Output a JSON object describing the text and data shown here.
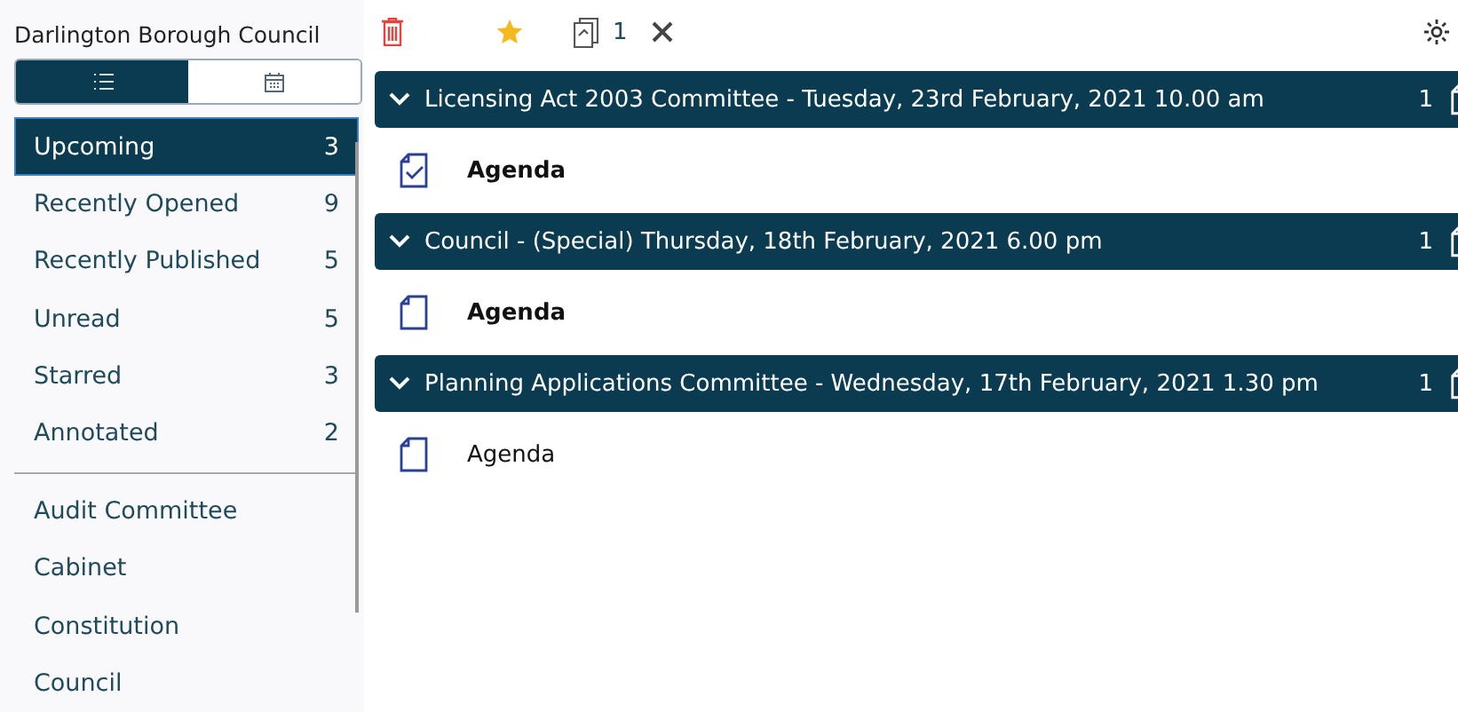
{
  "app_title": "Darlington Borough Council",
  "view_toggle": [
    {
      "kind": "list",
      "selected": true
    },
    {
      "kind": "calendar",
      "selected": false
    }
  ],
  "filters": [
    {
      "label": "Upcoming",
      "count": "3",
      "selected": true
    },
    {
      "label": "Recently Opened",
      "count": "9",
      "selected": false
    },
    {
      "label": "Recently Published",
      "count": "5",
      "selected": false
    },
    {
      "label": "Unread",
      "count": "5",
      "selected": false
    },
    {
      "label": "Starred",
      "count": "3",
      "selected": false
    },
    {
      "label": "Annotated",
      "count": "2",
      "selected": false
    }
  ],
  "committees": [
    "Audit Committee",
    "Cabinet",
    "Constitution",
    "Council"
  ],
  "toolbar": {
    "copy_count": "1"
  },
  "meetings": [
    {
      "title": "Licensing Act 2003 Committee - Tuesday, 23rd February, 2021 10.00 am",
      "count": "1",
      "expanded": true,
      "documents": [
        {
          "title": "Agenda",
          "unread": true,
          "kind": "checked"
        }
      ]
    },
    {
      "title": "Council - (Special) Thursday, 18th February, 2021 6.00 pm",
      "count": "1",
      "expanded": true,
      "documents": [
        {
          "title": "Agenda",
          "unread": true,
          "kind": "blank"
        }
      ]
    },
    {
      "title": "Planning Applications Committee - Wednesday, 17th February, 2021 1.30 pm",
      "count": "1",
      "expanded": true,
      "documents": [
        {
          "title": "Agenda",
          "unread": false,
          "kind": "blank"
        }
      ]
    }
  ]
}
